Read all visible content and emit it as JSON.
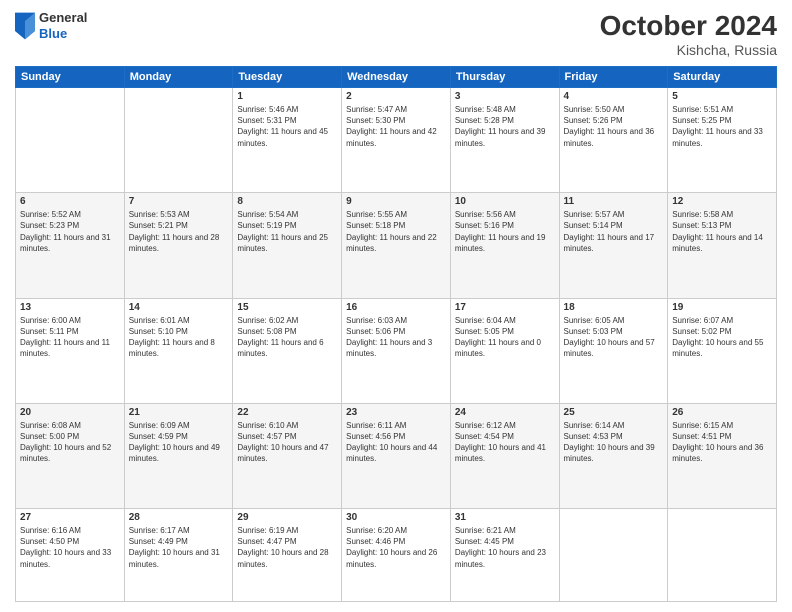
{
  "header": {
    "logo": {
      "general": "General",
      "blue": "Blue"
    },
    "title": "October 2024",
    "location": "Kishcha, Russia"
  },
  "weekdays": [
    "Sunday",
    "Monday",
    "Tuesday",
    "Wednesday",
    "Thursday",
    "Friday",
    "Saturday"
  ],
  "rows": [
    [
      {
        "day": "",
        "sunrise": "",
        "sunset": "",
        "daylight": "",
        "empty": true
      },
      {
        "day": "",
        "sunrise": "",
        "sunset": "",
        "daylight": "",
        "empty": true
      },
      {
        "day": "1",
        "sunrise": "Sunrise: 5:46 AM",
        "sunset": "Sunset: 5:31 PM",
        "daylight": "Daylight: 11 hours and 45 minutes.",
        "empty": false
      },
      {
        "day": "2",
        "sunrise": "Sunrise: 5:47 AM",
        "sunset": "Sunset: 5:30 PM",
        "daylight": "Daylight: 11 hours and 42 minutes.",
        "empty": false
      },
      {
        "day": "3",
        "sunrise": "Sunrise: 5:48 AM",
        "sunset": "Sunset: 5:28 PM",
        "daylight": "Daylight: 11 hours and 39 minutes.",
        "empty": false
      },
      {
        "day": "4",
        "sunrise": "Sunrise: 5:50 AM",
        "sunset": "Sunset: 5:26 PM",
        "daylight": "Daylight: 11 hours and 36 minutes.",
        "empty": false
      },
      {
        "day": "5",
        "sunrise": "Sunrise: 5:51 AM",
        "sunset": "Sunset: 5:25 PM",
        "daylight": "Daylight: 11 hours and 33 minutes.",
        "empty": false
      }
    ],
    [
      {
        "day": "6",
        "sunrise": "Sunrise: 5:52 AM",
        "sunset": "Sunset: 5:23 PM",
        "daylight": "Daylight: 11 hours and 31 minutes.",
        "empty": false
      },
      {
        "day": "7",
        "sunrise": "Sunrise: 5:53 AM",
        "sunset": "Sunset: 5:21 PM",
        "daylight": "Daylight: 11 hours and 28 minutes.",
        "empty": false
      },
      {
        "day": "8",
        "sunrise": "Sunrise: 5:54 AM",
        "sunset": "Sunset: 5:19 PM",
        "daylight": "Daylight: 11 hours and 25 minutes.",
        "empty": false
      },
      {
        "day": "9",
        "sunrise": "Sunrise: 5:55 AM",
        "sunset": "Sunset: 5:18 PM",
        "daylight": "Daylight: 11 hours and 22 minutes.",
        "empty": false
      },
      {
        "day": "10",
        "sunrise": "Sunrise: 5:56 AM",
        "sunset": "Sunset: 5:16 PM",
        "daylight": "Daylight: 11 hours and 19 minutes.",
        "empty": false
      },
      {
        "day": "11",
        "sunrise": "Sunrise: 5:57 AM",
        "sunset": "Sunset: 5:14 PM",
        "daylight": "Daylight: 11 hours and 17 minutes.",
        "empty": false
      },
      {
        "day": "12",
        "sunrise": "Sunrise: 5:58 AM",
        "sunset": "Sunset: 5:13 PM",
        "daylight": "Daylight: 11 hours and 14 minutes.",
        "empty": false
      }
    ],
    [
      {
        "day": "13",
        "sunrise": "Sunrise: 6:00 AM",
        "sunset": "Sunset: 5:11 PM",
        "daylight": "Daylight: 11 hours and 11 minutes.",
        "empty": false
      },
      {
        "day": "14",
        "sunrise": "Sunrise: 6:01 AM",
        "sunset": "Sunset: 5:10 PM",
        "daylight": "Daylight: 11 hours and 8 minutes.",
        "empty": false
      },
      {
        "day": "15",
        "sunrise": "Sunrise: 6:02 AM",
        "sunset": "Sunset: 5:08 PM",
        "daylight": "Daylight: 11 hours and 6 minutes.",
        "empty": false
      },
      {
        "day": "16",
        "sunrise": "Sunrise: 6:03 AM",
        "sunset": "Sunset: 5:06 PM",
        "daylight": "Daylight: 11 hours and 3 minutes.",
        "empty": false
      },
      {
        "day": "17",
        "sunrise": "Sunrise: 6:04 AM",
        "sunset": "Sunset: 5:05 PM",
        "daylight": "Daylight: 11 hours and 0 minutes.",
        "empty": false
      },
      {
        "day": "18",
        "sunrise": "Sunrise: 6:05 AM",
        "sunset": "Sunset: 5:03 PM",
        "daylight": "Daylight: 10 hours and 57 minutes.",
        "empty": false
      },
      {
        "day": "19",
        "sunrise": "Sunrise: 6:07 AM",
        "sunset": "Sunset: 5:02 PM",
        "daylight": "Daylight: 10 hours and 55 minutes.",
        "empty": false
      }
    ],
    [
      {
        "day": "20",
        "sunrise": "Sunrise: 6:08 AM",
        "sunset": "Sunset: 5:00 PM",
        "daylight": "Daylight: 10 hours and 52 minutes.",
        "empty": false
      },
      {
        "day": "21",
        "sunrise": "Sunrise: 6:09 AM",
        "sunset": "Sunset: 4:59 PM",
        "daylight": "Daylight: 10 hours and 49 minutes.",
        "empty": false
      },
      {
        "day": "22",
        "sunrise": "Sunrise: 6:10 AM",
        "sunset": "Sunset: 4:57 PM",
        "daylight": "Daylight: 10 hours and 47 minutes.",
        "empty": false
      },
      {
        "day": "23",
        "sunrise": "Sunrise: 6:11 AM",
        "sunset": "Sunset: 4:56 PM",
        "daylight": "Daylight: 10 hours and 44 minutes.",
        "empty": false
      },
      {
        "day": "24",
        "sunrise": "Sunrise: 6:12 AM",
        "sunset": "Sunset: 4:54 PM",
        "daylight": "Daylight: 10 hours and 41 minutes.",
        "empty": false
      },
      {
        "day": "25",
        "sunrise": "Sunrise: 6:14 AM",
        "sunset": "Sunset: 4:53 PM",
        "daylight": "Daylight: 10 hours and 39 minutes.",
        "empty": false
      },
      {
        "day": "26",
        "sunrise": "Sunrise: 6:15 AM",
        "sunset": "Sunset: 4:51 PM",
        "daylight": "Daylight: 10 hours and 36 minutes.",
        "empty": false
      }
    ],
    [
      {
        "day": "27",
        "sunrise": "Sunrise: 6:16 AM",
        "sunset": "Sunset: 4:50 PM",
        "daylight": "Daylight: 10 hours and 33 minutes.",
        "empty": false
      },
      {
        "day": "28",
        "sunrise": "Sunrise: 6:17 AM",
        "sunset": "Sunset: 4:49 PM",
        "daylight": "Daylight: 10 hours and 31 minutes.",
        "empty": false
      },
      {
        "day": "29",
        "sunrise": "Sunrise: 6:19 AM",
        "sunset": "Sunset: 4:47 PM",
        "daylight": "Daylight: 10 hours and 28 minutes.",
        "empty": false
      },
      {
        "day": "30",
        "sunrise": "Sunrise: 6:20 AM",
        "sunset": "Sunset: 4:46 PM",
        "daylight": "Daylight: 10 hours and 26 minutes.",
        "empty": false
      },
      {
        "day": "31",
        "sunrise": "Sunrise: 6:21 AM",
        "sunset": "Sunset: 4:45 PM",
        "daylight": "Daylight: 10 hours and 23 minutes.",
        "empty": false
      },
      {
        "day": "",
        "sunrise": "",
        "sunset": "",
        "daylight": "",
        "empty": true
      },
      {
        "day": "",
        "sunrise": "",
        "sunset": "",
        "daylight": "",
        "empty": true
      }
    ]
  ]
}
